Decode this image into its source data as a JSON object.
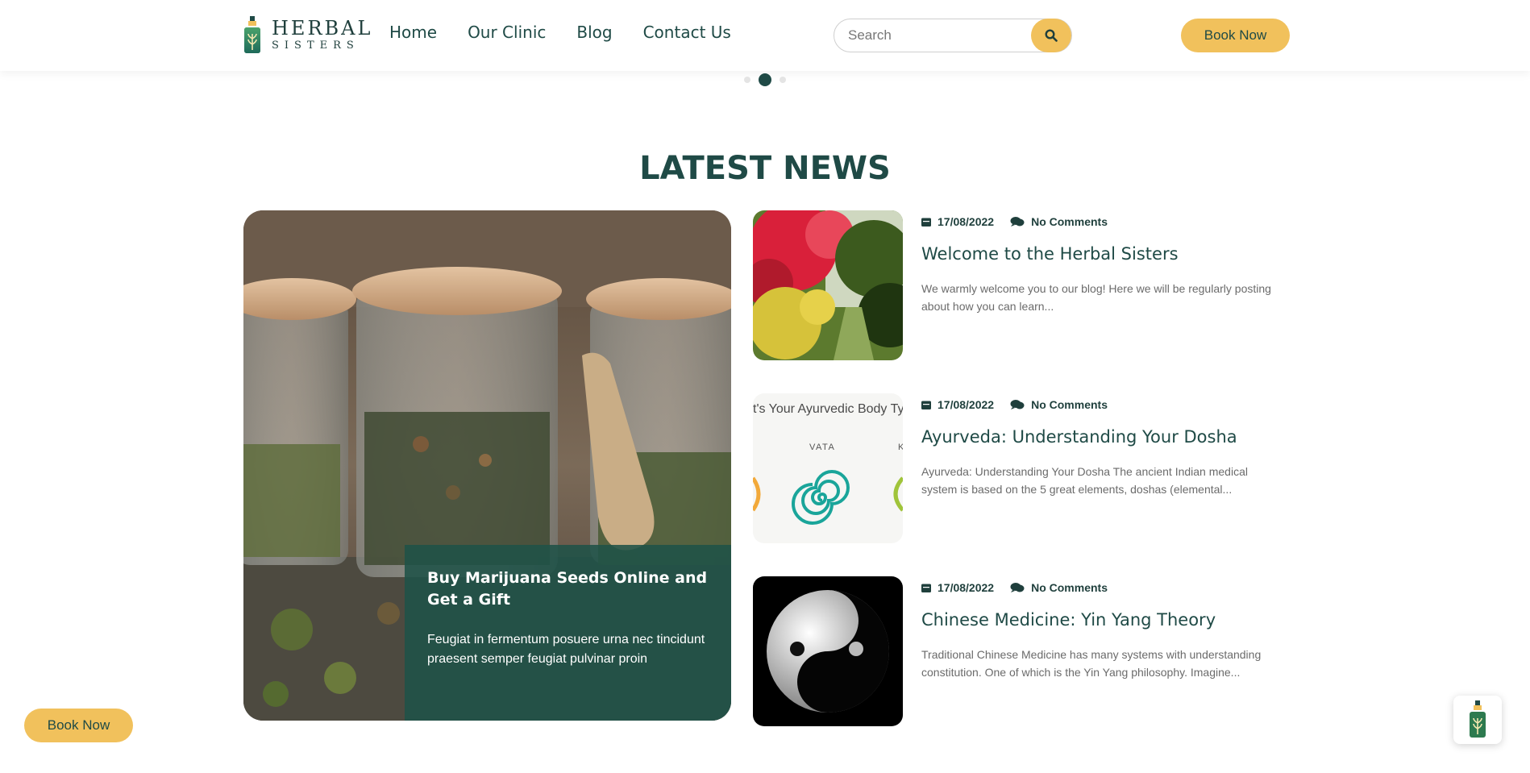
{
  "brand": {
    "line1": "HERBAL",
    "line2": "SISTERS",
    "primary_color": "#1f4a46",
    "accent_color": "#f1c15c"
  },
  "nav": {
    "items": [
      {
        "label": "Home"
      },
      {
        "label": "Our Clinic"
      },
      {
        "label": "Blog"
      },
      {
        "label": "Contact Us"
      }
    ]
  },
  "search": {
    "placeholder": "Search",
    "icon": "search-icon"
  },
  "header": {
    "book_label": "Book Now"
  },
  "slider": {
    "dot_count": 3,
    "active_index": 1
  },
  "section": {
    "title": "LATEST NEWS"
  },
  "featured": {
    "title": "Buy Marijuana Seeds Online and Get a Gift",
    "excerpt": "Feugiat in fermentum posuere urna nec tincidunt praesent semper feugiat pulvinar proin"
  },
  "posts": [
    {
      "date": "17/08/2022",
      "comments": "No Comments",
      "title": "Welcome to the Herbal Sisters",
      "excerpt": "We warmly welcome you to our blog! Here we will be regularly posting about how you can learn..."
    },
    {
      "date": "17/08/2022",
      "comments": "No Comments",
      "title": "Ayurveda: Understanding Your Dosha",
      "excerpt": "Ayurveda: Understanding Your Dosha The ancient Indian medical system is based on the 5 great elements, doshas (elemental...",
      "thumb_text": "t's Your Ayurvedic Body Ty",
      "thumb_label_1": "VATA",
      "thumb_label_2": "K"
    },
    {
      "date": "17/08/2022",
      "comments": "No Comments",
      "title": "Chinese Medicine: Yin Yang Theory",
      "excerpt": "Traditional Chinese Medicine has many systems with understanding constitution. One of which is the Yin Yang philosophy. Imagine..."
    }
  ],
  "floating": {
    "book_label": "Book Now"
  }
}
